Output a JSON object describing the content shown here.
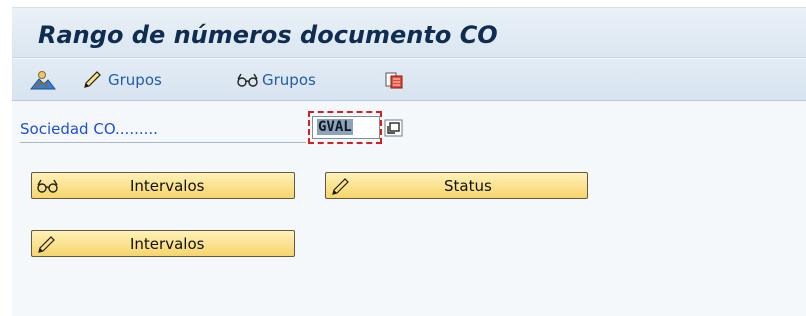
{
  "window": {
    "title": "Rango de números documento CO"
  },
  "toolbar": {
    "items": [
      {
        "icon": "mountain-person-icon",
        "label": ""
      },
      {
        "icon": "pencil-icon",
        "label": "Grupos"
      },
      {
        "icon": "glasses-icon",
        "label": "Grupos"
      },
      {
        "icon": "document-copy-icon",
        "label": ""
      }
    ]
  },
  "form": {
    "company_label": "Sociedad CO.........",
    "company_value": "GVAL"
  },
  "buttons": {
    "display_intervals": {
      "icon": "glasses-icon",
      "label": "Intervalos"
    },
    "change_status": {
      "icon": "pencil-icon",
      "label": "Status"
    },
    "change_intervals": {
      "icon": "pencil-icon",
      "label": "Intervalos"
    }
  },
  "colors": {
    "title": "#0f2d53",
    "link_blue": "#1f5ea8",
    "field_label": "#1f4ed8",
    "button_yellow": "#f7d56b",
    "focus_red": "#d62020"
  }
}
